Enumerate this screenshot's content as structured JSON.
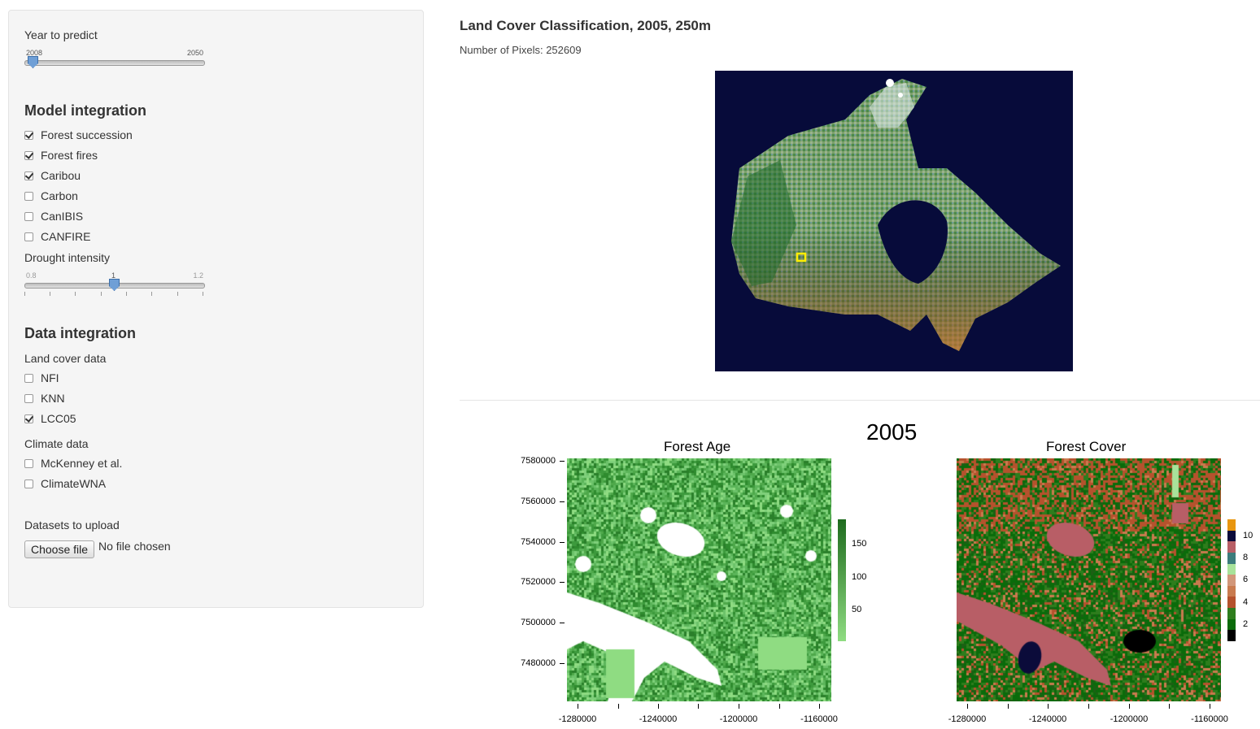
{
  "sidebar": {
    "year_label": "Year to predict",
    "year_slider": {
      "min": "2008",
      "max": "2050",
      "value": 2008
    },
    "model_heading": "Model integration",
    "models": [
      {
        "label": "Forest succession",
        "checked": true
      },
      {
        "label": "Forest fires",
        "checked": true
      },
      {
        "label": "Caribou",
        "checked": true
      },
      {
        "label": "Carbon",
        "checked": false
      },
      {
        "label": "CanIBIS",
        "checked": false
      },
      {
        "label": "CANFIRE",
        "checked": false
      }
    ],
    "drought_label": "Drought intensity",
    "drought_slider": {
      "min": "0.8",
      "max": "1.2",
      "value": "1"
    },
    "data_heading": "Data integration",
    "land_cover_label": "Land cover data",
    "land_cover": [
      {
        "label": "NFI",
        "checked": false
      },
      {
        "label": "KNN",
        "checked": false
      },
      {
        "label": "LCC05",
        "checked": true
      }
    ],
    "climate_label": "Climate data",
    "climate": [
      {
        "label": "McKenney et al.",
        "checked": false
      },
      {
        "label": "ClimateWNA",
        "checked": false
      }
    ],
    "upload_label": "Datasets to upload",
    "choose_file": "Choose file",
    "no_file": "No file chosen"
  },
  "main": {
    "title": "Land Cover Classification, 2005, 250m",
    "pixels": "Number of Pixels: 252609",
    "year": "2005"
  },
  "colors": {
    "map_bg": "#070b3a",
    "selection": "#ffee00",
    "age_ramp": [
      "#ffffff",
      "#8fdc82",
      "#1e6b1e"
    ],
    "cover_classes": [
      "#000000",
      "#0a6b0a",
      "#2e7d1d",
      "#b5522d",
      "#c97b4f",
      "#d2977a",
      "#a8e39a",
      "#3c7c7c",
      "#b85e66",
      "#0b0b3a",
      "#e8960f"
    ]
  },
  "chart_data": [
    {
      "type": "heatmap",
      "title": "Forest Age",
      "y_ticks": [
        "7580000",
        "7560000",
        "7540000",
        "7520000",
        "7500000",
        "7480000"
      ],
      "x_ticks": [
        "-1280000",
        "-1240000",
        "-1200000",
        "-1160000"
      ],
      "legend_ticks": [
        "150",
        "100",
        "50"
      ]
    },
    {
      "type": "heatmap",
      "title": "Forest Cover",
      "x_ticks": [
        "-1280000",
        "-1240000",
        "-1200000",
        "-1160000"
      ],
      "legend_ticks": [
        "10",
        "8",
        "6",
        "4",
        "2"
      ]
    }
  ]
}
